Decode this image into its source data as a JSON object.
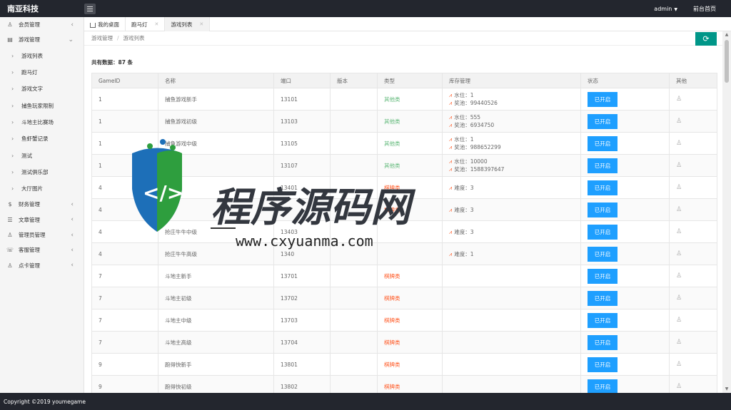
{
  "header": {
    "app_title": "南亚科技",
    "user": "admin",
    "front_home": "前台首页"
  },
  "sidebar": {
    "items": [
      {
        "label": "会员管理",
        "icon": "user-icon",
        "open": false
      },
      {
        "label": "游戏管理",
        "icon": "document-icon",
        "open": true,
        "children": [
          "游戏列表",
          "跑马灯",
          "游戏文字",
          "捕鱼玩家限制",
          "斗地主比赛场",
          "鱼虾蟹记录",
          "测试",
          "测试俱乐部",
          "大厅图片"
        ]
      },
      {
        "label": "财务管理",
        "icon": "dollar-icon",
        "open": false
      },
      {
        "label": "文章管理",
        "icon": "list-icon",
        "open": false
      },
      {
        "label": "管理员管理",
        "icon": "admin-icon",
        "open": false
      },
      {
        "label": "客服管理",
        "icon": "service-icon",
        "open": false
      },
      {
        "label": "点卡管理",
        "icon": "card-icon",
        "open": false
      }
    ]
  },
  "tabs": [
    {
      "label": "我的桌面",
      "home": true,
      "active": false
    },
    {
      "label": "跑马灯",
      "active": false
    },
    {
      "label": "游戏列表",
      "active": true
    }
  ],
  "breadcrumb": [
    "游戏管理",
    "游戏列表"
  ],
  "total": "共有数据：87 条",
  "table": {
    "headers": [
      "GameID",
      "名称",
      "端口",
      "版本",
      "类型",
      "库存管理",
      "状态",
      "其他"
    ],
    "rows": [
      {
        "id": "1",
        "name": "捕鱼游戏新手",
        "port": "13101",
        "version": "",
        "type": "其他类",
        "type_color": "green",
        "stock": [
          "水位：1",
          "奖池：99440526"
        ],
        "status": "已开启"
      },
      {
        "id": "1",
        "name": "捕鱼游戏初级",
        "port": "13103",
        "version": "",
        "type": "其他类",
        "type_color": "green",
        "stock": [
          "水位：555",
          "奖池：6934750"
        ],
        "status": "已开启"
      },
      {
        "id": "1",
        "name": "捕鱼游戏中级",
        "port": "13105",
        "version": "",
        "type": "其他类",
        "type_color": "green",
        "stock": [
          "水位：1",
          "奖池：988652299"
        ],
        "status": "已开启"
      },
      {
        "id": "1",
        "name": "",
        "port": "13107",
        "version": "",
        "type": "其他类",
        "type_color": "green",
        "stock": [
          "水位：10000",
          "奖池：1588397647"
        ],
        "status": "已开启"
      },
      {
        "id": "4",
        "name": "",
        "port": "13401",
        "version": "",
        "type": "棋牌类",
        "type_color": "red",
        "stock": [
          "难度：3"
        ],
        "status": "已开启"
      },
      {
        "id": "4",
        "name": "",
        "port": "",
        "version": "",
        "type": "棋牌类",
        "type_color": "red",
        "stock": [
          "难度：3"
        ],
        "status": "已开启"
      },
      {
        "id": "4",
        "name": "抢庄牛牛中级",
        "port": "13403",
        "version": "",
        "type": "",
        "type_color": "red",
        "stock": [
          "难度：3"
        ],
        "status": "已开启"
      },
      {
        "id": "4",
        "name": "抢庄牛牛高级",
        "port": "1340",
        "version": "",
        "type": "",
        "type_color": "red",
        "stock": [
          "难度：1"
        ],
        "status": "已开启"
      },
      {
        "id": "7",
        "name": "斗地主新手",
        "port": "13701",
        "version": "",
        "type": "棋牌类",
        "type_color": "red",
        "stock": [],
        "status": "已开启"
      },
      {
        "id": "7",
        "name": "斗地主初级",
        "port": "13702",
        "version": "",
        "type": "棋牌类",
        "type_color": "red",
        "stock": [],
        "status": "已开启"
      },
      {
        "id": "7",
        "name": "斗地主中级",
        "port": "13703",
        "version": "",
        "type": "棋牌类",
        "type_color": "red",
        "stock": [],
        "status": "已开启"
      },
      {
        "id": "7",
        "name": "斗地主高级",
        "port": "13704",
        "version": "",
        "type": "棋牌类",
        "type_color": "red",
        "stock": [],
        "status": "已开启"
      },
      {
        "id": "9",
        "name": "跑得快新手",
        "port": "13801",
        "version": "",
        "type": "棋牌类",
        "type_color": "red",
        "stock": [],
        "status": "已开启"
      },
      {
        "id": "9",
        "name": "跑得快初级",
        "port": "13802",
        "version": "",
        "type": "棋牌类",
        "type_color": "red",
        "stock": [],
        "status": "已开启"
      }
    ]
  },
  "footer": "Copyright ©2019 youmegame",
  "watermark": {
    "title": "程序源码网",
    "url": "www.cxyuanma.com"
  },
  "colors": {
    "topbar": "#23262e",
    "accent": "#009688",
    "button": "#1e9fff",
    "green": "#5fb878",
    "red": "#ff5722"
  }
}
